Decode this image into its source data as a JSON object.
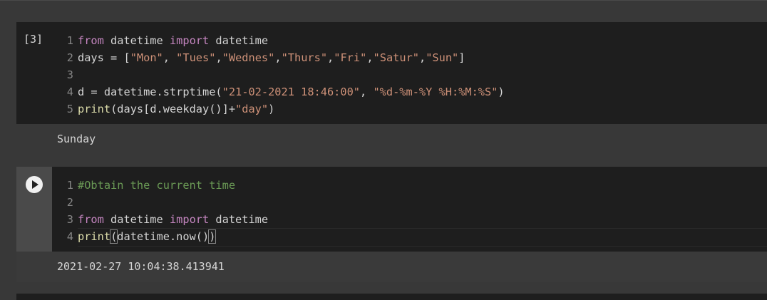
{
  "cells": [
    {
      "execution_count": "[3]",
      "lines": [
        {
          "n": "1"
        },
        {
          "n": "2"
        },
        {
          "n": "3"
        },
        {
          "n": "4"
        },
        {
          "n": "5"
        }
      ],
      "output": "Sunday"
    },
    {
      "lines": [
        {
          "n": "1"
        },
        {
          "n": "2"
        },
        {
          "n": "3"
        },
        {
          "n": "4"
        }
      ],
      "output": "2021-02-27 10:04:38.413941"
    }
  ],
  "code_tokens": {
    "c1l1": [
      "from",
      " datetime ",
      "import",
      " datetime"
    ],
    "c1l2": [
      "days = [",
      "\"Mon\"",
      ", ",
      "\"Tues\"",
      ",",
      "\"Wednes\"",
      ",",
      "\"Thurs\"",
      ",",
      "\"Fri\"",
      ",",
      "\"Satur\"",
      ",",
      "\"Sun\"",
      "]"
    ],
    "c1l4": [
      "d = datetime.strptime(",
      "\"21-02-2021 18:46:00\"",
      ", ",
      "\"%d-%m-%Y %H:%M:%S\"",
      ")"
    ],
    "c1l5": [
      "print",
      "(days[d.weekday()]+",
      "\"day\"",
      ")"
    ],
    "c2l1": [
      "#Obtain the current time"
    ],
    "c2l3": [
      "from",
      " datetime ",
      "import",
      " datetime"
    ],
    "c2l4": [
      "print",
      "(",
      "datetime.now()",
      ")"
    ]
  },
  "icons": {
    "run": "play-circle-icon"
  },
  "colors": {
    "keyword": "#c586c0",
    "string": "#ce9178",
    "comment": "#6a9955",
    "background": "#1e1e1e"
  }
}
